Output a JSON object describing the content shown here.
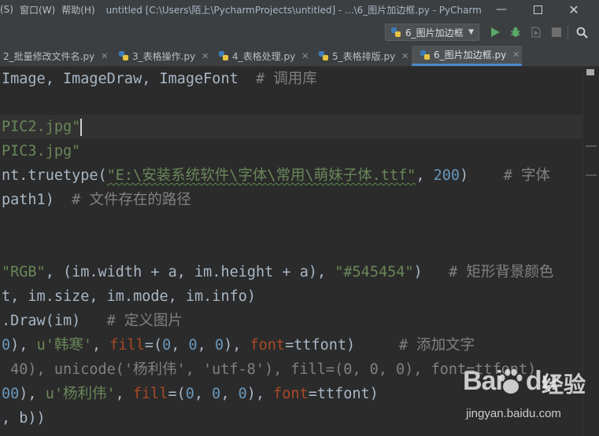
{
  "titlebar": {
    "menus": [
      "(S)",
      "窗口(W)",
      "帮助(H)"
    ],
    "title": "untitled [C:\\Users\\陌上\\PycharmProjects\\untitled] - ...\\6_图片加边框.py - PyCharm"
  },
  "toolbar": {
    "run_config": "6_图片加边框",
    "icons": [
      "run-icon",
      "debug-icon",
      "coverage-icon",
      "stop-icon",
      "search-icon"
    ]
  },
  "tabs": [
    {
      "label": "2_批量修改文件名.py",
      "active": false
    },
    {
      "label": "3_表格操作.py",
      "active": false
    },
    {
      "label": "4_表格处理.py",
      "active": false
    },
    {
      "label": "5_表格排版.py",
      "active": false
    },
    {
      "label": "6_图片加边框.py",
      "active": true
    }
  ],
  "code": {
    "l1": [
      "Image, ImageDraw, ImageFont  ",
      "# 调用库"
    ],
    "l2": [
      "PIC2.jpg\""
    ],
    "l3": [
      "PIC3.jpg\""
    ],
    "l4": [
      "nt.truetype(",
      "\"E:\\安装系统软件\\字体\\常用\\萌妹子体.ttf\"",
      ", ",
      "200",
      ")    ",
      "# 字体"
    ],
    "l5": [
      "path1)  ",
      "# 文件存在的路径"
    ],
    "l6": [
      "\"RGB\"",
      ", (im.width + a, im.height + a), ",
      "\"#545454\"",
      ")   ",
      "# 矩形背景颜色"
    ],
    "l7": [
      "t, im.size, im.mode, im.info)"
    ],
    "l8": [
      ".Draw(im)   ",
      "# 定义图片"
    ],
    "l9": [
      "0",
      "), ",
      "u'韩寒'",
      ", ",
      "fill",
      "=(",
      "0",
      ", ",
      "0",
      ", ",
      "0",
      "), ",
      "font",
      "=ttfont)     ",
      "# 添加文字"
    ],
    "l10": [
      " 40), unicode('杨利伟', 'utf-8'), fill=(0, 0, 0), font=ttfont)"
    ],
    "l11": [
      "00",
      "), ",
      "u'杨利伟'",
      ", ",
      "fill",
      "=(",
      "0",
      ", ",
      "0",
      ", ",
      "0",
      "), ",
      "font",
      "=ttfont)"
    ],
    "l12": [
      ", b))"
    ]
  },
  "watermark": {
    "brand": "Bai",
    "brand2": "du",
    "product": "经验",
    "url": "jingyan.baidu.com"
  },
  "colors": {
    "keyword": "#cc7832",
    "string": "#6a8759",
    "number": "#6897bb",
    "comment": "#808080",
    "param": "#aa4926",
    "text": "#a9b7c6"
  }
}
